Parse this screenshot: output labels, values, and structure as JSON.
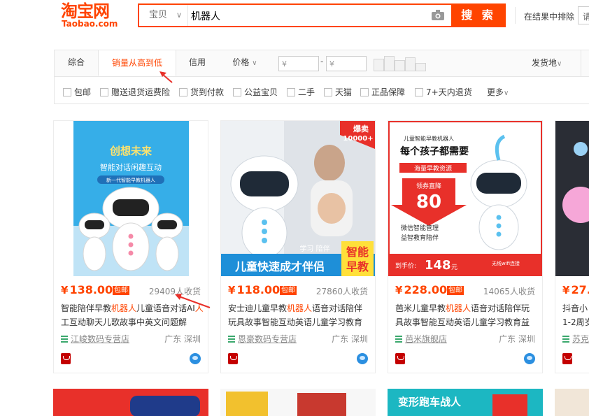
{
  "header": {
    "logo_cn": "淘宝网",
    "logo_en": "Taobao.com",
    "search_scope": "宝贝",
    "search_value": "机器人",
    "search_button": "搜 索",
    "refine_label": "在结果中排除",
    "refine_placeholder": "请"
  },
  "sort_tabs": [
    {
      "label": "综合"
    },
    {
      "label": "销量从高到低"
    },
    {
      "label": "信用"
    },
    {
      "label": "价格"
    }
  ],
  "price_filter": {
    "min_placeholder": "¥",
    "max_placeholder": "¥",
    "dash": "-"
  },
  "ship_to": "发货地",
  "filters": [
    "包邮",
    "赠送退货运费险",
    "货到付款",
    "公益宝贝",
    "二手",
    "天猫",
    "正品保障",
    "7+天内退货"
  ],
  "more_label": "更多",
  "chevron_glyph": "∨",
  "free_ship_badge": "包邮",
  "currency": "¥",
  "products": [
    {
      "price": "138.00",
      "deals": "29409人收货",
      "title_before": "智能陪伴早教",
      "title_hl": "机器人",
      "title_mid": "儿童语音对话AI",
      "title_hl2": "人",
      "title_after": "工互动聊天儿歌故事中英文问题解",
      "shop": "江峻数码专营店",
      "location": "广东 深圳",
      "pic_banner": "创想未来",
      "pic_sub": "智能对话闲趣互动",
      "pic_tag": "新一代智能早教机器人"
    },
    {
      "price": "118.00",
      "deals": "27860人收货",
      "title_before": "安士迪儿童早教",
      "title_hl": "机器人",
      "title_mid": "语音对话陪伴",
      "title_hl2": "",
      "title_after": "玩具故事智能互动英语儿童学习教育",
      "shop": "恩豪数码专营店",
      "location": "广东 深圳",
      "pic_hot": "爆卖",
      "pic_hot_num": "10000+",
      "pic_slogan": "儿童快速成才伴侣",
      "pic_tag1": "智能",
      "pic_tag2": "早教",
      "pic_small": "学习 陪伴"
    },
    {
      "price": "228.00",
      "deals": "14065人收货",
      "title_before": "芭米儿童早教",
      "title_hl": "机器人",
      "title_mid": "语音对话陪伴玩",
      "title_hl2": "",
      "title_after": "具故事智能互动英语儿童学习教育益",
      "shop": "芭米旗舰店",
      "location": "广东 深圳",
      "pic_top": "儿童智能早教机器人",
      "pic_headline": "每个孩子都需要",
      "pic_res": "海量早教资源",
      "pic_coupon": "领券直降",
      "pic_num": "80",
      "pic_f1": "微信智能管理",
      "pic_f2": "益智教育陪伴",
      "pic_hand": "到手价:",
      "pic_hand_price": "148",
      "pic_unit": "元",
      "pic_wifi": "无线wifi连接"
    },
    {
      "price": "27.",
      "title_line1": "抖音小",
      "title_line2": "1-2周岁",
      "shop": "苏克"
    }
  ],
  "bottom_cards": [
    {
      "label": ""
    },
    {
      "label": ""
    },
    {
      "label": "变形跑车战人"
    },
    {
      "label": ""
    }
  ],
  "colors": {
    "accent": "#ff4400",
    "shop_green": "#3ba86d",
    "annotation": "#e8302a"
  }
}
